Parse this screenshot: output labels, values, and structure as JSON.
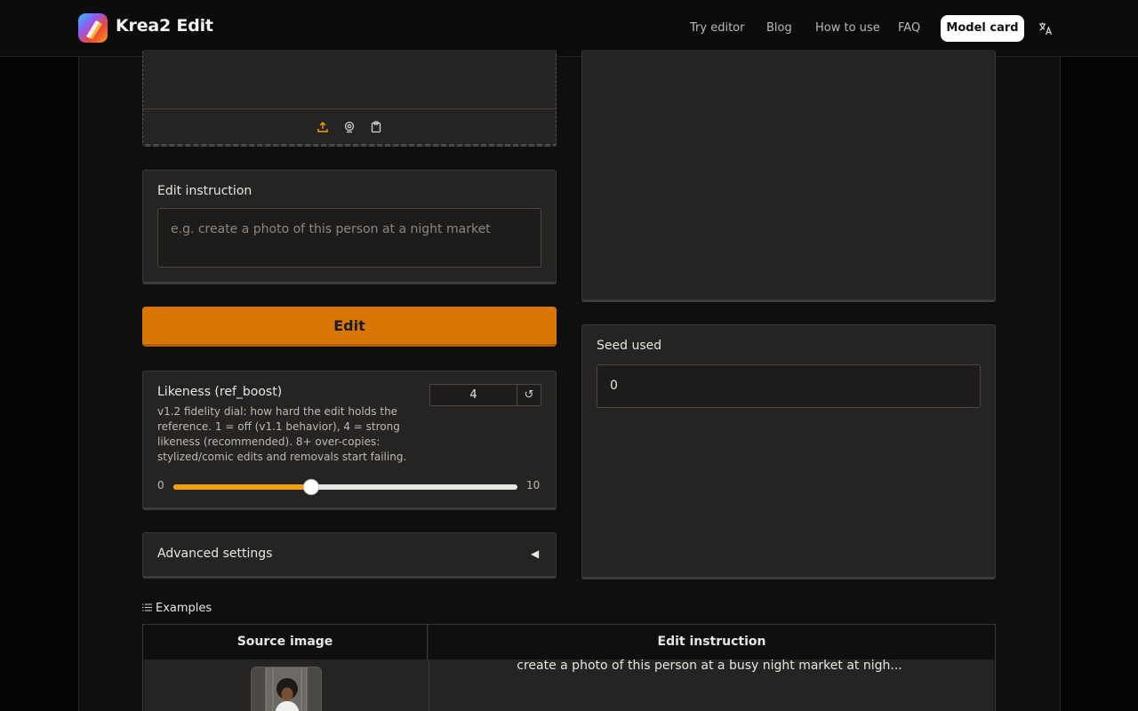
{
  "header": {
    "brand": "Krea2 Edit",
    "nav": [
      "Try editor",
      "Blog",
      "How to use",
      "FAQ"
    ],
    "model_card": "Model card"
  },
  "input": {
    "edit_label": "Edit instruction",
    "edit_placeholder": "e.g. create a photo of this person at a night market",
    "edit_button": "Edit"
  },
  "likeness": {
    "label": "Likeness (ref_boost)",
    "value": "4",
    "reset": "↺",
    "description": "v1.2 fidelity dial: how hard the edit holds the reference. 1 = off (v1.1 behavior), 4 = strong likeness (recommended). 8+ over-copies: stylized/comic edits and removals start failing.",
    "min": "0",
    "max": "10",
    "slider_value": 4,
    "slider_max": 10
  },
  "advanced": {
    "label": "Advanced settings",
    "arrow": "◀"
  },
  "output": {
    "seed_label": "Seed used",
    "seed_value": "0"
  },
  "examples": {
    "label": "Examples",
    "headers": [
      "Source image",
      "Edit instruction"
    ],
    "rows": [
      {
        "instruction": "create a photo of this person at a busy night market at nigh..."
      }
    ]
  },
  "colors": {
    "accent": "#d97706",
    "slider_fill": "#f59e0b",
    "background": "#050506",
    "panel": "#262423"
  }
}
